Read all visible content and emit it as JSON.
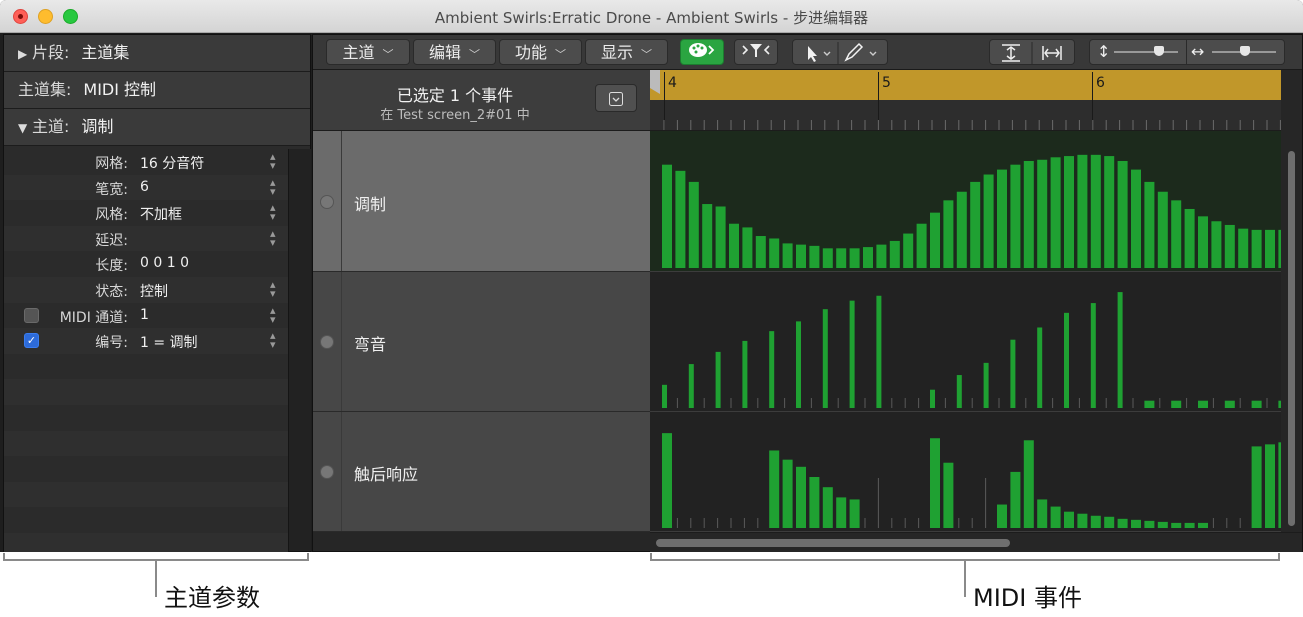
{
  "window": {
    "title": "Ambient Swirls:Erratic Drone - Ambient Swirls - 步进编辑器"
  },
  "inspector": {
    "segment": {
      "key": "片段:",
      "value": "主道集"
    },
    "laneset": {
      "key": "主道集:",
      "value": "MIDI 控制"
    },
    "lane": {
      "key": "主道:",
      "value": "调制"
    },
    "params": [
      {
        "label": "网格:",
        "value": "16 分音符",
        "stepper": true,
        "checkbox": null
      },
      {
        "label": "笔宽:",
        "value": "6",
        "stepper": true,
        "checkbox": null
      },
      {
        "label": "风格:",
        "value": "不加框",
        "stepper": true,
        "checkbox": null
      },
      {
        "label": "延迟:",
        "value": "",
        "stepper": true,
        "checkbox": null
      },
      {
        "label": "长度:",
        "value": "0 0 1     0",
        "stepper": false,
        "checkbox": null
      },
      {
        "label": "状态:",
        "value": "控制",
        "stepper": true,
        "checkbox": null
      },
      {
        "label": "MIDI 通道:",
        "value": "1",
        "stepper": true,
        "checkbox": false
      },
      {
        "label": "编号:",
        "value": "1 = 调制",
        "stepper": true,
        "checkbox": true
      }
    ]
  },
  "toolbar": {
    "menus": [
      "主道",
      "编辑",
      "功能",
      "显示"
    ],
    "midi_in_icon": "palette-midi-in-icon",
    "catch_icon": "catch-playhead-icon",
    "pointer_tool_icon": "pointer-tool-icon",
    "pencil_tool_icon": "pencil-tool-icon",
    "fit_vertical_icon": "fit-vertical-icon",
    "fit_horizontal_icon": "fit-horizontal-icon",
    "vertical_zoom_icon": "vertical-zoom-icon",
    "horizontal_zoom_icon": "horizontal-zoom-icon"
  },
  "selection": {
    "line1": "已选定 1 个事件",
    "line2": "在 Test screen_2#01 中"
  },
  "ruler": {
    "bars": [
      "4",
      "5",
      "6"
    ]
  },
  "lanes": [
    {
      "name": "调制",
      "selected": true,
      "values": [
        0.84,
        0.79,
        0.7,
        0.52,
        0.5,
        0.36,
        0.33,
        0.26,
        0.24,
        0.2,
        0.19,
        0.18,
        0.16,
        0.16,
        0.16,
        0.17,
        0.19,
        0.22,
        0.28,
        0.36,
        0.45,
        0.55,
        0.62,
        0.7,
        0.76,
        0.8,
        0.84,
        0.87,
        0.88,
        0.9,
        0.91,
        0.92,
        0.92,
        0.91,
        0.87,
        0.8,
        0.7,
        0.62,
        0.55,
        0.48,
        0.42,
        0.38,
        0.35,
        0.32,
        0.31,
        0.31,
        0.31,
        0.31
      ]
    },
    {
      "name": "弯音",
      "selected": false,
      "values": [
        0.19,
        0,
        0.36,
        0,
        0.46,
        0,
        0.55,
        0,
        0.63,
        0,
        0.71,
        0,
        0.81,
        0,
        0.88,
        0,
        0.92,
        0,
        0,
        0,
        0.15,
        0,
        0.27,
        0,
        0.37,
        0,
        0.56,
        0,
        0.66,
        0,
        0.78,
        0,
        0.86,
        0,
        0.95,
        0,
        0.06,
        0,
        0.06,
        0,
        0.06,
        0,
        0.06,
        0,
        0.06,
        0,
        0.06,
        0
      ]
    },
    {
      "name": "触后响应",
      "selected": false,
      "values": [
        0.93,
        0,
        0,
        0,
        0,
        0,
        0,
        0,
        0.76,
        0.67,
        0.6,
        0.5,
        0.4,
        0.3,
        0.28,
        0,
        0,
        0,
        0,
        0,
        0.88,
        0.64,
        0,
        0,
        0,
        0.23,
        0.55,
        0.86,
        0.28,
        0.21,
        0.16,
        0.14,
        0.12,
        0.11,
        0.09,
        0.08,
        0.07,
        0.06,
        0.05,
        0.05,
        0.05,
        0,
        0,
        0,
        0.8,
        0.82,
        0.84,
        0.85
      ]
    }
  ],
  "labels": {
    "left": "主道参数",
    "right": "MIDI 事件"
  },
  "colors": {
    "bar": "#1fa132",
    "ruler_bar": "#c1972a",
    "lane_sel_bg": "#1c2a1c",
    "lane_bg": "#222222"
  }
}
